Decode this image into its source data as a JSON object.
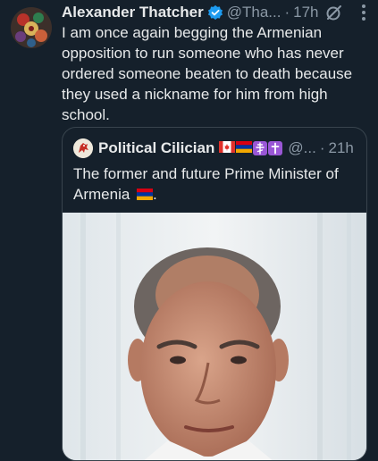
{
  "tweet": {
    "author_name": "Alexander Thatcher",
    "handle": "@Tha...",
    "separator": "·",
    "time": "17h",
    "text": "I am once again begging the Armenian opposition to run someone who has never ordered someone beaten to death because they used a nickname for him from high school."
  },
  "quoted_tweet": {
    "author_name": "Political Cilician",
    "handle": "@...",
    "separator": "·",
    "time": "21h",
    "text": "The former and future Prime Minister of Armenia",
    "text_flag": "armenia-flag"
  },
  "icons": {
    "verified": "verified-badge-icon",
    "grok": "grok-icon",
    "more": "more-options-icon",
    "flags": [
      "canada-flag",
      "armenia-flag",
      "orthodox-cross-emoji",
      "latin-cross-emoji"
    ]
  },
  "colors": {
    "background": "#15202b",
    "text_primary": "#e7e9ea",
    "text_secondary": "#8b98a5",
    "border": "#38444d",
    "verified_blue": "#1d9bf0",
    "cross_badge_purple": "#9a57d6"
  }
}
